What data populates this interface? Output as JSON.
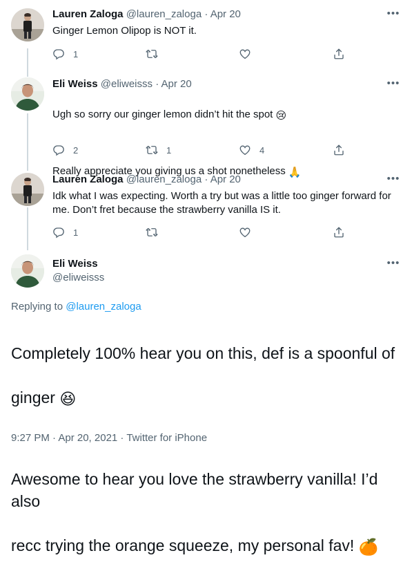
{
  "tweets": [
    {
      "name": "Lauren Zaloga",
      "handle": "@lauren_zaloga",
      "separator": "·",
      "date": "Apr 20",
      "text": "Ginger Lemon Olipop is NOT it.",
      "replies": "1",
      "retweets": "",
      "likes": ""
    },
    {
      "name": "Eli Weiss",
      "handle": "@eliweisss",
      "separator": "·",
      "date": "Apr 20",
      "text_line1": "Ugh so sorry our ginger lemon didn’t hit the spot",
      "emoji1": "😢",
      "text_line2": "Really appreciate you giving us a shot nonetheless",
      "emoji2": "🙏",
      "replies": "2",
      "retweets": "1",
      "likes": "4"
    },
    {
      "name": "Lauren Zaloga",
      "handle": "@lauren_zaloga",
      "separator": "·",
      "date": "Apr 20",
      "text": "Idk what I was expecting. Worth a try but was a little too ginger forward for me. Don’t fret because the strawberry vanilla IS it.",
      "replies": "1",
      "retweets": "",
      "likes": ""
    }
  ],
  "main_tweet": {
    "name": "Eli Weiss",
    "handle": "@eliweisss",
    "replying_prefix": "Replying to",
    "replying_to": "@lauren_zaloga",
    "para1_line1": "Completely 100% hear you on this, def is a spoonful of",
    "para1_line2": "ginger",
    "emoji_laugh": "😆",
    "para2_line1": "Awesome to hear you love the strawberry vanilla! I’d also",
    "para2_line2": "recc trying the orange squeeze, my personal fav!",
    "emoji_orange": "🍊",
    "footer": "9:27 PM · Apr 20, 2021 · Twitter for iPhone"
  },
  "icons": [
    "reply-icon",
    "retweet-icon",
    "like-icon",
    "share-icon",
    "more-icon"
  ],
  "colors": {
    "text": "#0f1419",
    "secondary": "#536471",
    "link": "#1d9bf0",
    "thread_line": "#cfd9de"
  }
}
